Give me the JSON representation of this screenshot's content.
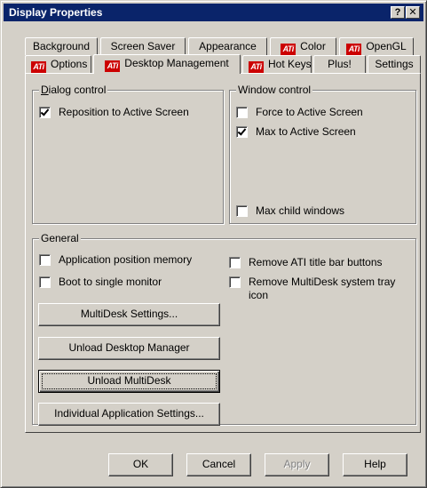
{
  "window": {
    "title": "Display Properties"
  },
  "titlebar_buttons": {
    "help": "?",
    "close": "✕"
  },
  "tabs_row1": [
    {
      "label": "Background",
      "ati": false
    },
    {
      "label": "Screen Saver",
      "ati": false
    },
    {
      "label": "Appearance",
      "ati": false
    },
    {
      "label": "Color",
      "ati": true
    },
    {
      "label": "OpenGL",
      "ati": true
    }
  ],
  "tabs_row2": [
    {
      "label": "Options",
      "ati": true
    },
    {
      "label": "Desktop Management",
      "ati": true,
      "active": true
    },
    {
      "label": "Hot Keys",
      "ati": true
    },
    {
      "label": "Plus!",
      "ati": false
    },
    {
      "label": "Settings",
      "ati": false
    }
  ],
  "ati_logo_text": "ATi",
  "dialog_control": {
    "label": "Dialog control",
    "items": [
      {
        "label": "Reposition to Active Screen",
        "checked": true
      }
    ]
  },
  "window_control": {
    "label": "Window control",
    "items": [
      {
        "label": "Force to Active Screen",
        "checked": false
      },
      {
        "label": "Max to Active Screen",
        "checked": true
      },
      {
        "label": "Max child windows",
        "checked": false
      }
    ]
  },
  "general": {
    "label": "General",
    "left_items": [
      {
        "label": "Application position memory",
        "checked": false
      },
      {
        "label": "Boot to single monitor",
        "checked": false
      }
    ],
    "right_items": [
      {
        "label": "Remove ATI title bar buttons",
        "checked": false
      },
      {
        "label": "Remove MultiDesk system tray",
        "label2": "icon",
        "checked": false
      }
    ],
    "buttons": {
      "multidesk_settings": "MultiDesk Settings...",
      "unload_desktop_manager": "Unload Desktop Manager",
      "unload_multidesk": "Unload MultiDesk",
      "individual_app_settings": "Individual Application Settings..."
    }
  },
  "footer": {
    "ok": "OK",
    "cancel": "Cancel",
    "apply": "Apply",
    "help": "Help"
  },
  "colors": {
    "titlebar": "#0a246a",
    "face": "#d4d0c8",
    "ati_red": "#cc0000"
  }
}
